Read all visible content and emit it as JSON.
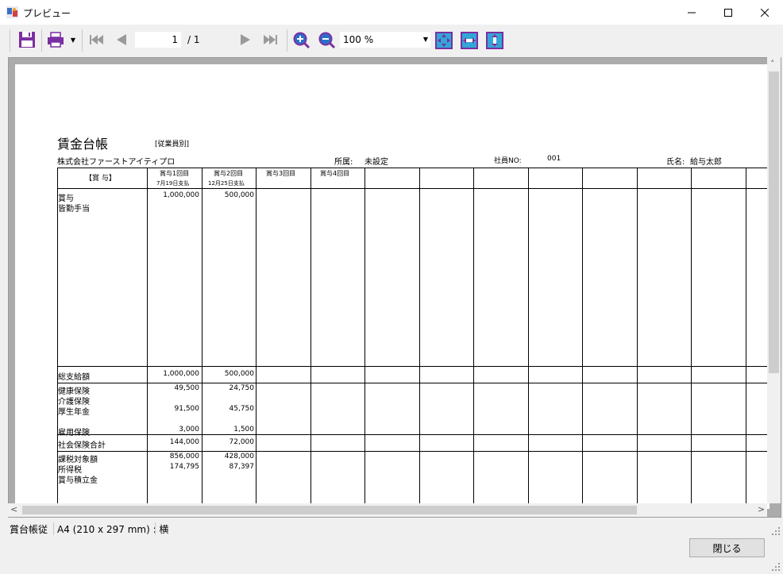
{
  "window": {
    "title": "プレビュー"
  },
  "toolbar": {
    "page_current": "1",
    "page_total": "/ 1",
    "zoom": "100 %",
    "icons": [
      "save-icon",
      "print-icon",
      "first-page-icon",
      "prev-page-icon",
      "next-page-icon",
      "last-page-icon",
      "zoom-in-icon",
      "zoom-out-icon",
      "fit-page-icon",
      "fit-width-icon",
      "fit-height-icon"
    ]
  },
  "report": {
    "title": "賃金台帳",
    "subtitle": "[従業員別]",
    "company": "株式会社ファーストアイティプロ",
    "dept_label": "所属:",
    "dept_value": "未設定",
    "empno_label": "社員NO:",
    "empno_value": "001",
    "name_label": "氏名:",
    "name_value": "給与太郎",
    "table": {
      "header_label": "【賞 与】",
      "columns": [
        {
          "title": "賞与1回目",
          "sub": "7月19日支払"
        },
        {
          "title": "賞与2回目",
          "sub": "12月25日支払"
        },
        {
          "title": "賞与3回目",
          "sub": ""
        },
        {
          "title": "賞与4回目",
          "sub": ""
        }
      ],
      "pay_items": [
        "賞与",
        "皆勤手当"
      ],
      "pay_values": [
        [
          "1,000,000",
          "500,000"
        ]
      ],
      "total_label": "総支給額",
      "total_values": [
        "1,000,000",
        "500,000"
      ],
      "insurance_items": [
        "健康保険",
        "介護保険",
        "厚生年金",
        "",
        "雇用保険"
      ],
      "insurance_values": [
        [
          "49,500",
          "24,750"
        ],
        [
          "",
          ""
        ],
        [
          "91,500",
          "45,750"
        ],
        [
          "",
          ""
        ],
        [
          "3,000",
          "1,500"
        ]
      ],
      "social_total_label": "社会保険合計",
      "social_total_values": [
        "144,000",
        "72,000"
      ],
      "tax_items": [
        "課税対象額",
        "所得税",
        "賞与積立金"
      ],
      "tax_values": [
        [
          "856,000",
          "428,000"
        ],
        [
          "174,795",
          "87,397"
        ],
        [
          "",
          ""
        ]
      ]
    }
  },
  "status": {
    "doc_name": "賞台帳従",
    "paper": "A4 (210 x 297 mm) : 横"
  },
  "close_label": "閉じる",
  "colors": {
    "accent_purple": "#7b2fa0",
    "icon_blue": "#2a6fc9",
    "icon_cyan": "#32a6d8"
  }
}
